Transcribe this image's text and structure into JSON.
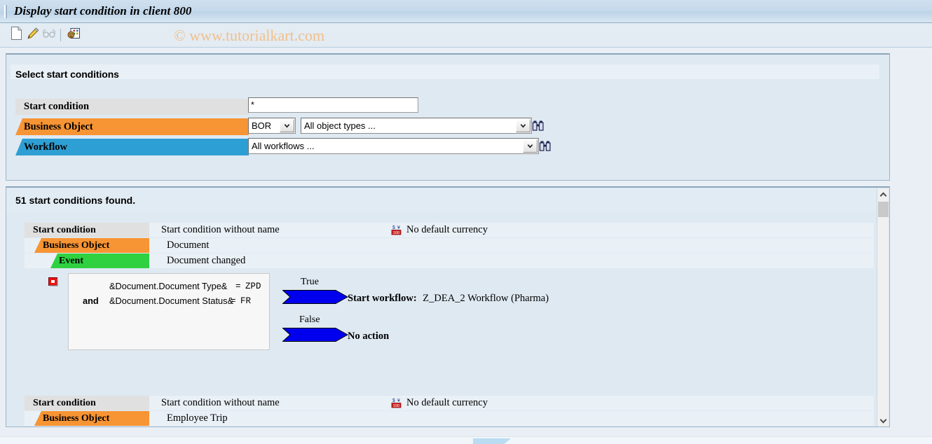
{
  "window": {
    "title": "Display start condition in client 800"
  },
  "toolbar": {
    "buttons": [
      {
        "name": "create",
        "icon": "document-icon",
        "enabled": true
      },
      {
        "name": "change",
        "icon": "pencil-icon",
        "enabled": true
      },
      {
        "name": "display",
        "icon": "glasses-icon",
        "enabled": false
      },
      {
        "name": "simulate-event",
        "icon": "event-simulation-icon",
        "enabled": true
      }
    ]
  },
  "watermark": "© www.tutorialkart.com",
  "selection": {
    "group_title": "Select start conditions",
    "rows": [
      {
        "label": "Start condition",
        "label_style": "plain",
        "value": "*",
        "type": "text"
      },
      {
        "label": "Business Object",
        "label_style": "orange",
        "prefix_select": "BOR",
        "value": "All object types ...",
        "type": "select",
        "search_icon": "binoculars-icon"
      },
      {
        "label": "Workflow",
        "label_style": "blue",
        "value": "All workflows ...",
        "type": "select",
        "search_icon": "binoculars-icon"
      }
    ]
  },
  "results": {
    "found_text": "51 start conditions found.",
    "entries": [
      {
        "rows": [
          {
            "label": "Start condition",
            "label_style": "plain",
            "value": "Start condition without name",
            "extra_icon": "currency-icon",
            "extra_text": "No default currency"
          },
          {
            "label": "Business Object",
            "label_style": "orange",
            "value": "Document"
          },
          {
            "label": "Event",
            "label_style": "green",
            "value": "Document changed"
          }
        ],
        "condition": {
          "status_icon": "red-stop-icon",
          "lines": [
            {
              "operator": "",
              "expression": "&Document.Document Type&",
              "comparator": "=",
              "value": "ZPD"
            },
            {
              "operator": "and",
              "expression": "&Document.Document Status&",
              "comparator": "=",
              "value": "FR"
            }
          ]
        },
        "branches": [
          {
            "label": "True",
            "action_prefix": "Start workflow:",
            "action_value": "Z_DEA_2 Workflow (Pharma)"
          },
          {
            "label": "False",
            "action_prefix": "No action",
            "action_value": ""
          }
        ]
      },
      {
        "rows": [
          {
            "label": "Start condition",
            "label_style": "plain",
            "value": "Start condition without name",
            "extra_icon": "currency-icon",
            "extra_text": "No default currency"
          },
          {
            "label": "Business Object",
            "label_style": "orange",
            "value": "Employee Trip"
          }
        ]
      }
    ]
  },
  "scrollbar": {
    "up_icon": "chevron-up-icon",
    "down_icon": "chevron-down-icon",
    "thumb": "scroll-thumb"
  },
  "colors": {
    "orange": "#f79433",
    "blue": "#2e9fd4",
    "green": "#2fd141",
    "grey": "#e0e0e0",
    "arrow_blue": "#0000ee",
    "watermark": "#f0c08a"
  }
}
